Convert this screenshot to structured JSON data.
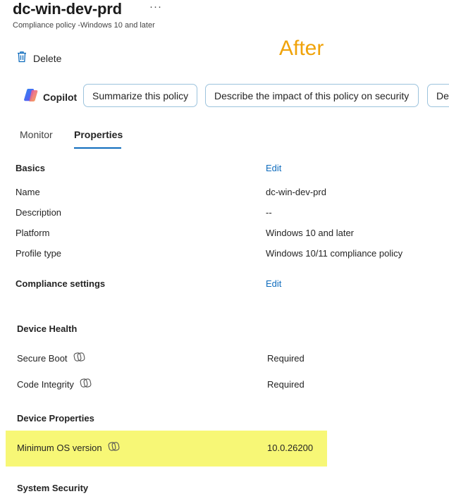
{
  "header": {
    "title": "dc-win-dev-prd",
    "more_label": "···",
    "subtitle": "Compliance policy -Windows 10 and later"
  },
  "annotation": {
    "text": "After",
    "color": "#f0a30a"
  },
  "toolbar": {
    "delete_label": "Delete"
  },
  "copilot": {
    "label": "Copilot",
    "prompts": [
      "Summarize this policy",
      "Describe the impact of this policy on security",
      "De"
    ]
  },
  "tabs": [
    {
      "label": "Monitor",
      "active": false
    },
    {
      "label": "Properties",
      "active": true
    }
  ],
  "basics": {
    "heading": "Basics",
    "edit_label": "Edit",
    "rows": [
      {
        "label": "Name",
        "value": "dc-win-dev-prd"
      },
      {
        "label": "Description",
        "value": "--"
      },
      {
        "label": "Platform",
        "value": "Windows 10 and later"
      },
      {
        "label": "Profile type",
        "value": "Windows 10/11 compliance policy"
      }
    ]
  },
  "compliance": {
    "heading": "Compliance settings",
    "edit_label": "Edit",
    "groups": [
      {
        "heading": "Device Health",
        "rows": [
          {
            "label": "Secure Boot",
            "value": "Required"
          },
          {
            "label": "Code Integrity",
            "value": "Required"
          }
        ]
      },
      {
        "heading": "Device Properties",
        "rows": [
          {
            "label": "Minimum OS version",
            "value": "10.0.26200"
          }
        ]
      },
      {
        "heading": "System Security",
        "rows": []
      }
    ]
  },
  "colors": {
    "accent": "#0f6cbd",
    "pill_border": "#9cc3dd",
    "highlight": "#f7f776"
  },
  "icons": {
    "delete": "trash-icon",
    "copilot": "copilot-logo-icon",
    "setting": "settings-catalog-icon"
  }
}
